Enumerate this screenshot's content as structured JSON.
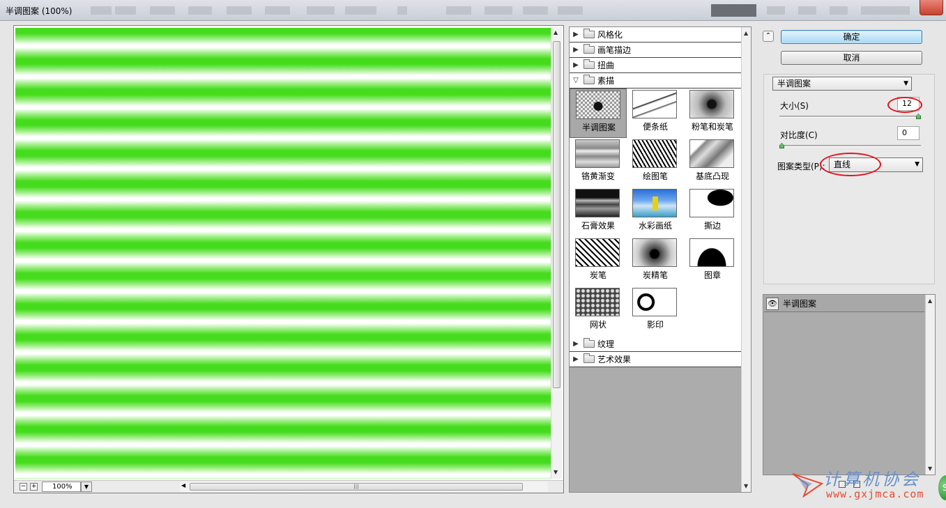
{
  "window": {
    "title": "半调图案 (100%)"
  },
  "preview": {
    "zoom": "100%",
    "stripe_colors": [
      "#46dc1e",
      "#ffffff"
    ]
  },
  "zoom_controls": {
    "minus": "−",
    "plus": "+",
    "dropdown": "▼",
    "grip": "|||"
  },
  "gallery": {
    "categories_top": [
      {
        "label": "风格化",
        "expanded": false
      },
      {
        "label": "画笔描边",
        "expanded": false
      },
      {
        "label": "扭曲",
        "expanded": false
      },
      {
        "label": "素描",
        "expanded": true
      }
    ],
    "filters": [
      {
        "label": "半调图案",
        "selected": true,
        "thumb": "t-half"
      },
      {
        "label": "便条纸",
        "selected": false,
        "thumb": "t-note"
      },
      {
        "label": "粉笔和炭笔",
        "selected": false,
        "thumb": "t-chalk"
      },
      {
        "label": "铬黄渐变",
        "selected": false,
        "thumb": "t-chrome"
      },
      {
        "label": "绘图笔",
        "selected": false,
        "thumb": "t-graphic"
      },
      {
        "label": "基底凸现",
        "selected": false,
        "thumb": "t-base"
      },
      {
        "label": "石膏效果",
        "selected": false,
        "thumb": "t-plaster"
      },
      {
        "label": "水彩画纸",
        "selected": false,
        "thumb": "t-water"
      },
      {
        "label": "撕边",
        "selected": false,
        "thumb": "t-torn"
      },
      {
        "label": "炭笔",
        "selected": false,
        "thumb": "t-charc"
      },
      {
        "label": "炭精笔",
        "selected": false,
        "thumb": "t-conte"
      },
      {
        "label": "图章",
        "selected": false,
        "thumb": "t-stamp"
      },
      {
        "label": "网状",
        "selected": false,
        "thumb": "t-net"
      },
      {
        "label": "影印",
        "selected": false,
        "thumb": "t-photo"
      }
    ],
    "categories_bottom": [
      {
        "label": "纹理",
        "expanded": false
      },
      {
        "label": "艺术效果",
        "expanded": false
      }
    ]
  },
  "actions": {
    "ok": "确定",
    "cancel": "取消",
    "collapse_glyph": "⌃"
  },
  "settings": {
    "filter_select": "半调图案",
    "size_label": "大小(S)",
    "size_value": "12",
    "size_fraction": 1.0,
    "contrast_label": "对比度(C)",
    "contrast_value": "0",
    "contrast_fraction": 0.0,
    "pattern_label": "图案类型(P):",
    "pattern_value": "直线",
    "highlight_color": "#e0141e"
  },
  "layers": {
    "item": "半调图案",
    "eye_glyph": "👁"
  },
  "watermark": {
    "text": "计算机协会",
    "url": "www.gxjmca.com"
  }
}
